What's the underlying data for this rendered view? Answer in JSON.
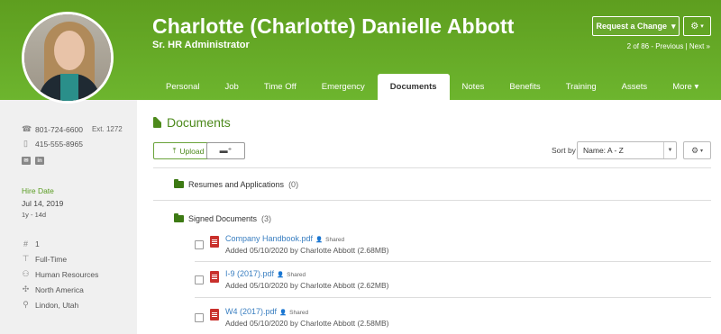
{
  "employee": {
    "name": "Charlotte (Charlotte) Danielle Abbott",
    "job_title": "Sr. HR Administrator"
  },
  "header": {
    "request_change": "Request a Change",
    "pager_text": "2 of 86 - Previous | Next »"
  },
  "tabs": [
    {
      "label": "Personal"
    },
    {
      "label": "Job"
    },
    {
      "label": "Time Off"
    },
    {
      "label": "Emergency"
    },
    {
      "label": "Documents",
      "active": true
    },
    {
      "label": "Notes"
    },
    {
      "label": "Benefits"
    },
    {
      "label": "Training"
    },
    {
      "label": "Assets"
    },
    {
      "label": "More ▾"
    }
  ],
  "sidebar": {
    "work_phone": "801-724-6600",
    "ext": "Ext. 1272",
    "mobile_phone": "415-555-8965",
    "hire_label": "Hire Date",
    "hire_date": "Jul 14, 2019",
    "hire_duration": "1y - 14d",
    "employee_number": "1",
    "employment_status": "Full-Time",
    "department": "Human Resources",
    "division": "North America",
    "location": "Lindon, Utah"
  },
  "documents": {
    "title": "Documents",
    "upload_label": "Upload",
    "sort_label": "Sort by",
    "sort_value": "Name: A - Z",
    "folders": [
      {
        "name": "Resumes and Applications",
        "count": "(0)"
      },
      {
        "name": "Signed Documents",
        "count": "(3)"
      }
    ],
    "files": [
      {
        "name": "Company Handbook.pdf",
        "shared": "Shared",
        "meta": "Added 05/10/2020 by Charlotte Abbott (2.68MB)"
      },
      {
        "name": "I-9 (2017).pdf",
        "shared": "Shared",
        "meta": "Added 05/10/2020 by Charlotte Abbott (2.62MB)"
      },
      {
        "name": "W4 (2017).pdf",
        "shared": "Shared",
        "meta": "Added 05/10/2020 by Charlotte Abbott (2.58MB)"
      }
    ]
  },
  "colors": {
    "brand_green": "#6db52e",
    "link_blue": "#3a7fc1",
    "pdf_red": "#c9302c"
  }
}
